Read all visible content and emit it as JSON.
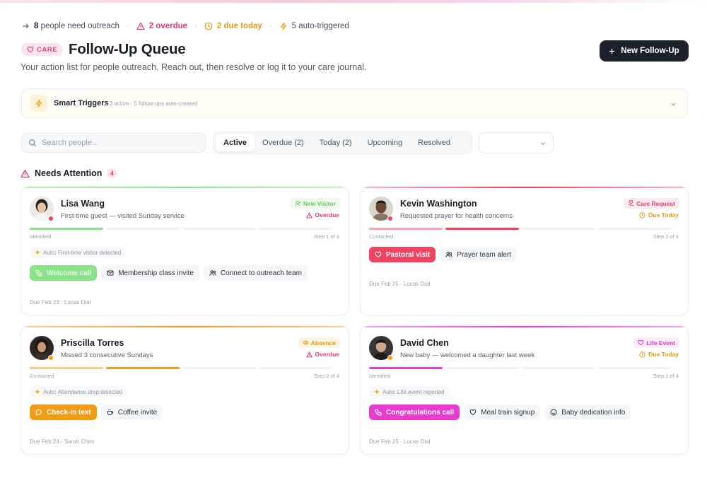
{
  "stats": {
    "need_outreach_count": "8",
    "need_outreach_label": "people need outreach",
    "overdue": "2 overdue",
    "due_today": "2 due today",
    "auto_triggered": "5 auto-triggered"
  },
  "header": {
    "badge": "CARE",
    "title": "Follow-Up Queue",
    "subtitle": "Your action list for people outreach. Reach out, then resolve or log it to your care journal.",
    "new_button": "New Follow-Up"
  },
  "triggers": {
    "title": "Smart Triggers",
    "meta": "3 active · 5 follow-ups auto-created"
  },
  "filters": {
    "search_placeholder": "Search people...",
    "tabs": [
      "Active",
      "Overdue (2)",
      "Today (2)",
      "Upcoming",
      "Resolved"
    ],
    "select_value": ""
  },
  "section": {
    "title": "Needs Attention",
    "count": "4"
  },
  "colors": {
    "green": "#8be28b",
    "pink": "#f0435f",
    "orange": "#f29b16",
    "magenta": "#e83bd0"
  },
  "cards": [
    {
      "name": "Lisa Wang",
      "description": "First-time guest — visited Sunday service",
      "type": "New Visitor",
      "type_icon": "user-plus-icon",
      "state": "Overdue",
      "stage": "Identified",
      "step": "Step 1 of 4",
      "steps_done": 1,
      "auto_note": "Auto: First-time visitor detected",
      "actions": [
        "Welcome call",
        "Membership class invite",
        "Connect to outreach team"
      ],
      "due": "Due Feb 23 · Lucas Dial"
    },
    {
      "name": "Kevin Washington",
      "description": "Requested prayer for health concerns",
      "type": "Care Request",
      "type_icon": "hand-heart-icon",
      "state": "Due Today",
      "stage": "Contacted",
      "step": "Step 2 of 4",
      "steps_done": 2,
      "auto_note": "",
      "actions": [
        "Pastoral visit",
        "Prayer team alert"
      ],
      "due": "Due Feb 25 · Lucas Dial"
    },
    {
      "name": "Priscilla Torres",
      "description": "Missed 3 consecutive Sundays",
      "type": "Absence",
      "type_icon": "eye-icon",
      "state": "Overdue",
      "stage": "Contacted",
      "step": "Step 2 of 4",
      "steps_done": 2,
      "auto_note": "Auto: Attendance drop detected",
      "actions": [
        "Check-in text",
        "Coffee invite"
      ],
      "due": "Due Feb 24 · Sarah Chen"
    },
    {
      "name": "David Chen",
      "description": "New baby — welcomed a daughter last week",
      "type": "Life Event",
      "type_icon": "heart-icon",
      "state": "Due Today",
      "stage": "Identified",
      "step": "Step 1 of 4",
      "steps_done": 1,
      "auto_note": "Auto: Life event reported",
      "actions": [
        "Congratulations call",
        "Meal train signup",
        "Baby dedication info"
      ],
      "due": "Due Feb 25 · Lucas Dial"
    }
  ]
}
